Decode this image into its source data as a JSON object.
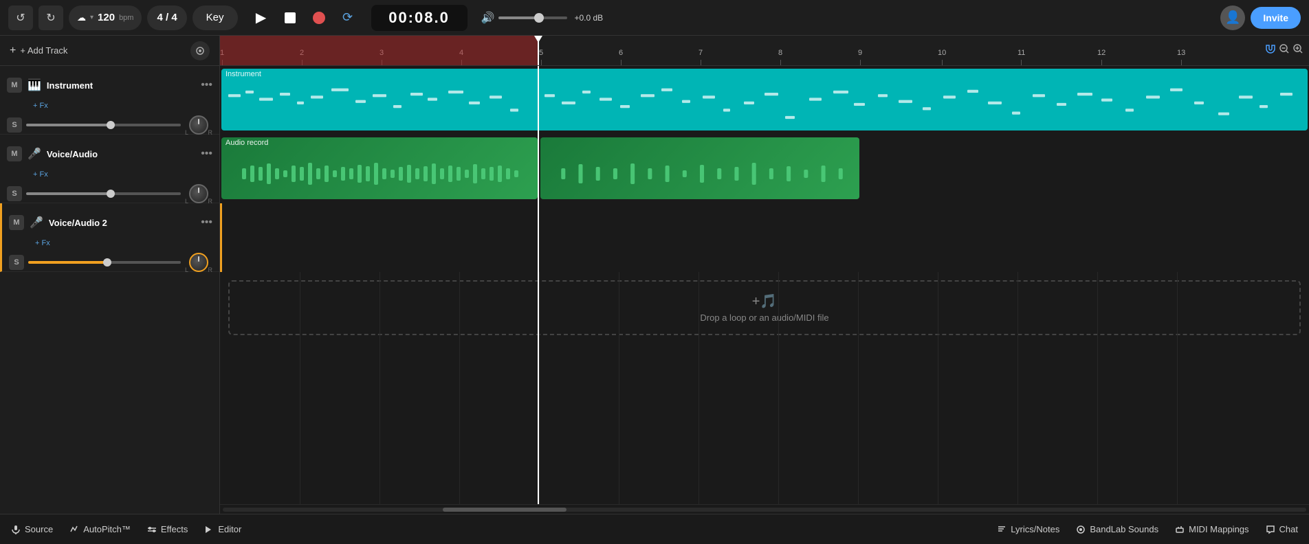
{
  "topbar": {
    "undo_label": "↺",
    "redo_label": "↻",
    "tempo_value": "120",
    "tempo_unit": "bpm",
    "time_sig": "4 / 4",
    "key_label": "Key",
    "play_label": "▶",
    "stop_label": "■",
    "record_label": "●",
    "loop_label": "⟳",
    "time_display": "00:08.0",
    "volume_label": "🔊",
    "db_value": "+0.0 dB",
    "invite_label": "Invite"
  },
  "tracks": {
    "add_label": "+ Add Track",
    "track1": {
      "name": "Instrument",
      "mute": "M",
      "solo": "S",
      "fx": "+ Fx",
      "icon": "🎹",
      "clip_label": "Instrument"
    },
    "track2": {
      "name": "Voice/Audio",
      "mute": "M",
      "solo": "S",
      "fx": "+ Fx",
      "icon": "🎤",
      "clip_label": "Audio record"
    },
    "track3": {
      "name": "Voice/Audio 2",
      "mute": "M",
      "solo": "S",
      "fx": "+ Fx",
      "icon": "🎤"
    }
  },
  "dropzone": {
    "icon": "🎵",
    "text": "Drop a loop or an audio/MIDI file"
  },
  "bottombar": {
    "source_label": "Source",
    "autopitch_label": "AutoPitch™",
    "effects_label": "Effects",
    "editor_label": "Editor",
    "lyrics_label": "Lyrics/Notes",
    "bandlab_label": "BandLab Sounds",
    "midi_label": "MIDI Mappings",
    "chat_label": "Chat"
  },
  "ruler": {
    "marks": [
      1,
      2,
      3,
      4,
      5,
      6,
      7,
      8,
      9,
      10,
      11,
      12,
      13
    ]
  },
  "colors": {
    "accent_blue": "#4a9eff",
    "instrument_teal": "#00b5b5",
    "audio_green": "#2da050",
    "record_red": "#e05050",
    "loop_orange": "#f0a020"
  }
}
